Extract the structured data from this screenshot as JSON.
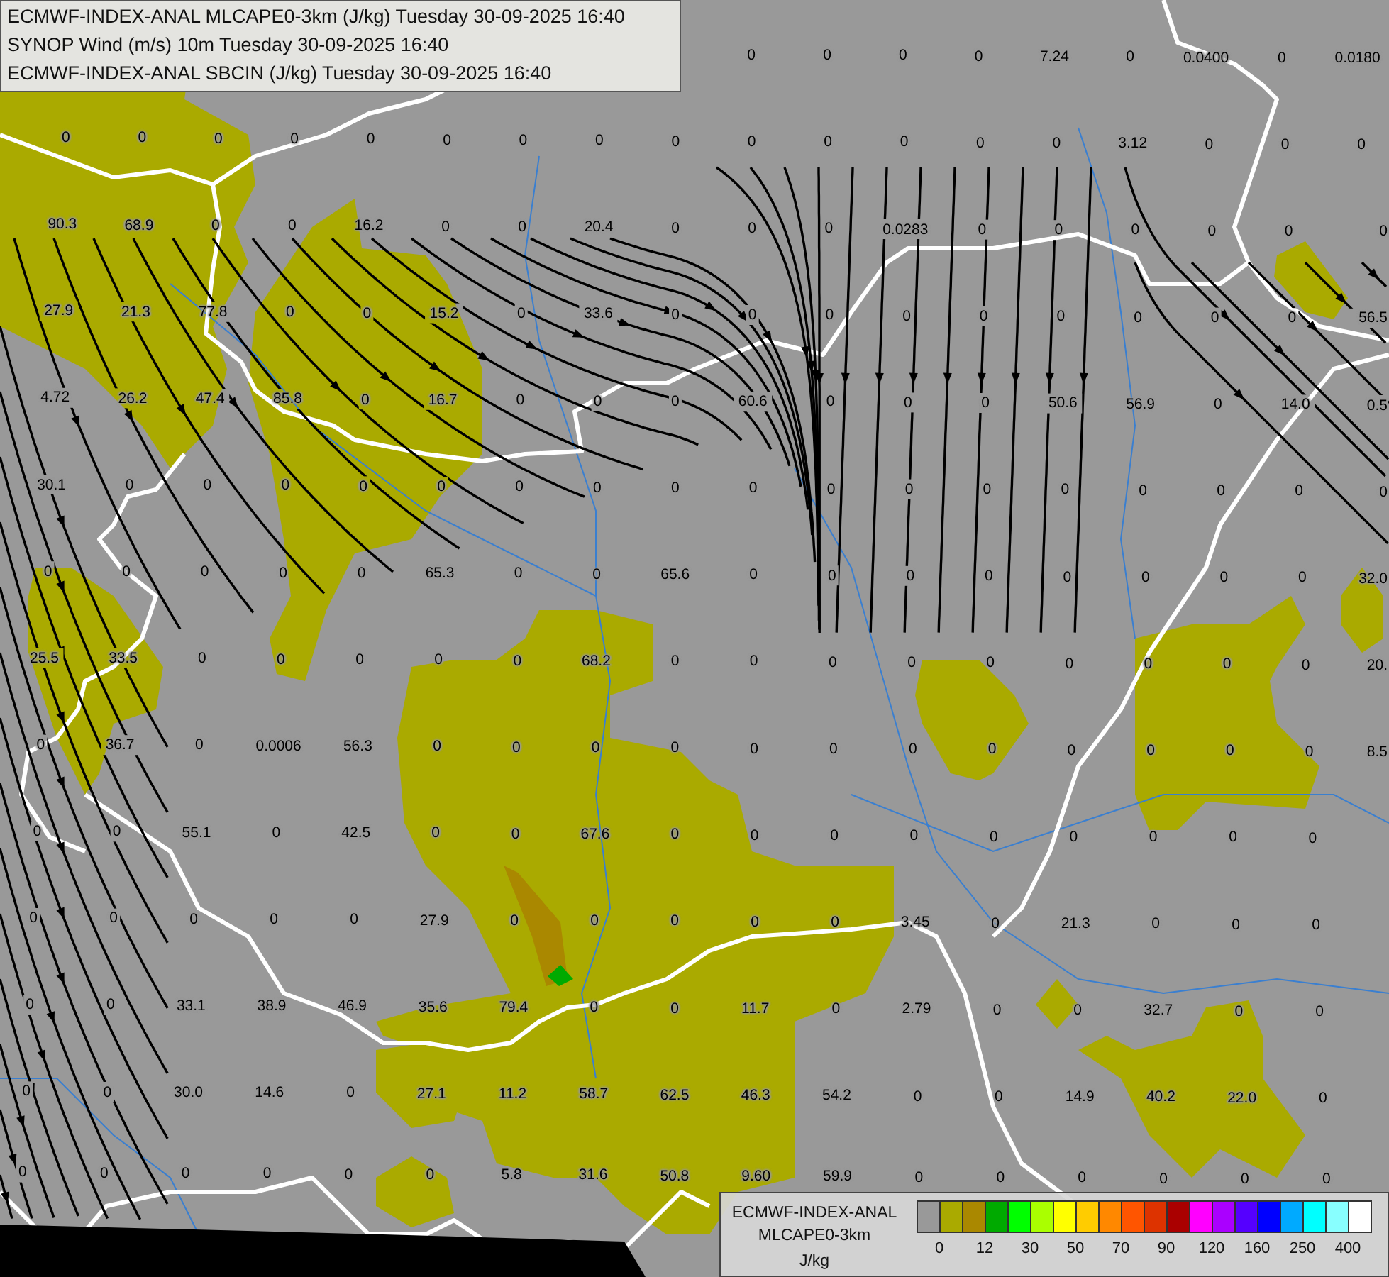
{
  "title_lines": [
    "ECMWF-INDEX-ANAL MLCAPE0-3km (J/kg) Tuesday 30-09-2025 16:40",
    "SYNOP Wind (m/s) 10m Tuesday 30-09-2025 16:40",
    "ECMWF-INDEX-ANAL SBCIN (J/kg) Tuesday 30-09-2025 16:40"
  ],
  "map": {
    "cape_grid": [
      [
        "0",
        "0",
        "0",
        "0",
        "7.24",
        "0",
        "0.0400",
        "0",
        "0.0180"
      ],
      [
        "0",
        "0",
        "0",
        "0",
        "0",
        "0",
        "0",
        "0",
        "0",
        "0",
        "0",
        "0",
        "0",
        "0",
        "3.12",
        "0",
        "0",
        "0"
      ],
      [
        "90.3",
        "68.9",
        "0",
        "0",
        "16.2",
        "0",
        "0",
        "20.4",
        "0",
        "0",
        "0",
        "0.0283",
        "0",
        "0",
        "0",
        "0",
        "0",
        "0"
      ],
      [
        "27.9",
        "21.3",
        "77.8",
        "0",
        "0",
        "15.2",
        "0",
        "33.6",
        "0",
        "0",
        "0",
        "0",
        "0",
        "0",
        "0",
        "0",
        "0",
        "56.5"
      ],
      [
        "4.72",
        "26.2",
        "47.4",
        "85.8",
        "0",
        "16.7",
        "0",
        "0",
        "0",
        "60.6",
        "0",
        "0",
        "0",
        "50.6",
        "56.9",
        "0",
        "14.0",
        "0.5"
      ],
      [
        "30.1",
        "0",
        "0",
        "0",
        "0",
        "0",
        "0",
        "0",
        "0",
        "0",
        "0",
        "0",
        "0",
        "0",
        "0",
        "0",
        "0",
        "0"
      ],
      [
        "0",
        "0",
        "0",
        "0",
        "0",
        "65.3",
        "0",
        "0",
        "65.6",
        "0",
        "0",
        "0",
        "0",
        "0",
        "0",
        "0",
        "0",
        "32.0"
      ],
      [
        "25.5",
        "33.5",
        "0",
        "0",
        "0",
        "0",
        "0",
        "68.2",
        "0",
        "0",
        "0",
        "0",
        "0",
        "0",
        "0",
        "0",
        "0",
        "20."
      ],
      [
        "0",
        "36.7",
        "0",
        "0.0006",
        "56.3",
        "0",
        "0",
        "0",
        "0",
        "0",
        "0",
        "0",
        "0",
        "0",
        "0",
        "0",
        "0",
        "8.5"
      ],
      [
        "0",
        "0",
        "55.1",
        "0",
        "42.5",
        "0",
        "0",
        "67.6",
        "0",
        "0",
        "0",
        "0",
        "0",
        "0",
        "0",
        "0",
        "0"
      ],
      [
        "0",
        "0",
        "0",
        "0",
        "0",
        "27.9",
        "0",
        "0",
        "0",
        "0",
        "0",
        "3.45",
        "0",
        "21.3",
        "0",
        "0",
        "0"
      ],
      [
        "0",
        "0",
        "33.1",
        "38.9",
        "46.9",
        "35.6",
        "79.4",
        "0",
        "0",
        "11.7",
        "0",
        "2.79",
        "0",
        "0",
        "32.7",
        "0",
        "0"
      ],
      [
        "0",
        "0",
        "30.0",
        "14.6",
        "0",
        "27.1",
        "11.2",
        "58.7",
        "62.5",
        "46.3",
        "54.2",
        "0",
        "0",
        "14.9",
        "40.2",
        "22.0",
        "0"
      ],
      [
        "0",
        "0",
        "0",
        "0",
        "0",
        "0",
        "5.8",
        "31.6",
        "50.8",
        "9.60",
        "59.9",
        "0",
        "0",
        "0",
        "0",
        "0",
        "0"
      ]
    ]
  },
  "legend": {
    "title_lines": [
      "ECMWF-INDEX-ANAL",
      "MLCAPE0-3km"
    ],
    "unit": "J/kg",
    "swatches": [
      {
        "color": "#999999"
      },
      {
        "color": "#aaaa00"
      },
      {
        "color": "#aa8800"
      },
      {
        "color": "#00aa00"
      },
      {
        "color": "#00ff00"
      },
      {
        "color": "#aaff00"
      },
      {
        "color": "#ffff00"
      },
      {
        "color": "#ffcc00"
      },
      {
        "color": "#ff8800"
      },
      {
        "color": "#ff5500"
      },
      {
        "color": "#dd3300"
      },
      {
        "color": "#aa0000"
      },
      {
        "color": "#ff00ff"
      },
      {
        "color": "#aa00ff"
      },
      {
        "color": "#5500ff"
      },
      {
        "color": "#0000ff"
      },
      {
        "color": "#00aaff"
      },
      {
        "color": "#00ffff"
      },
      {
        "color": "#88ffff"
      },
      {
        "color": "#ffffff"
      }
    ],
    "ticks": [
      "0",
      "12",
      "30",
      "50",
      "70",
      "90",
      "120",
      "160",
      "250",
      "400"
    ]
  }
}
